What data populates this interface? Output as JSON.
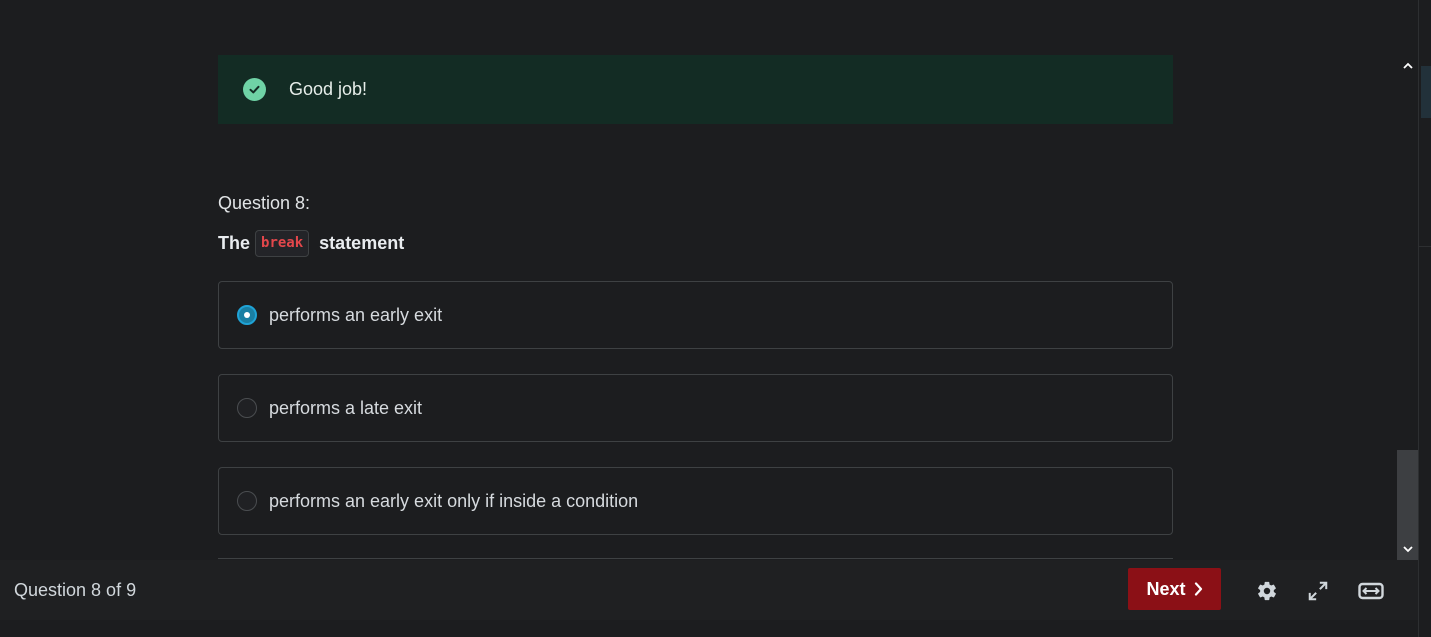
{
  "feedback": {
    "message": "Good job!",
    "icon": "check-circle-icon",
    "color": "#132c24",
    "icon_color": "#6fd3a6"
  },
  "question": {
    "number_label": "Question 8:",
    "prompt_before": "The",
    "prompt_code": "break",
    "prompt_after": "statement"
  },
  "options": [
    {
      "label": "performs an early exit",
      "selected": true
    },
    {
      "label": "performs a late exit",
      "selected": false
    },
    {
      "label": "performs an early exit only if inside a condition",
      "selected": false
    }
  ],
  "footer": {
    "status": "Question 8 of 9",
    "next_label": "Next",
    "next_color": "#8b1016",
    "icons": [
      "settings-icon",
      "fullscreen-icon",
      "expand-width-icon"
    ]
  },
  "scrollbar": {
    "up_icon": "chevron-up-icon",
    "down_icon": "chevron-down-icon"
  }
}
